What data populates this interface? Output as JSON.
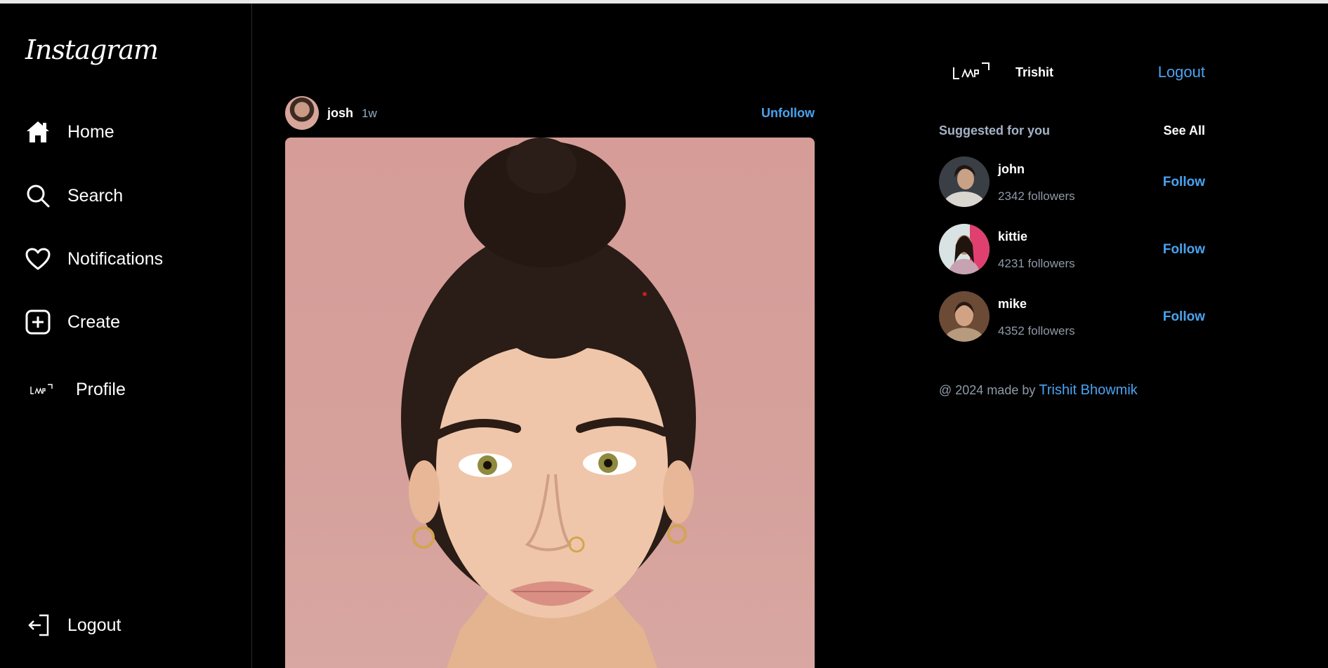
{
  "app": {
    "logo_text": "Instagram"
  },
  "sidebar": {
    "items": [
      {
        "label": "Home",
        "icon": "home-icon"
      },
      {
        "label": "Search",
        "icon": "search-icon"
      },
      {
        "label": "Notifications",
        "icon": "heart-icon"
      },
      {
        "label": "Create",
        "icon": "plus-square-icon"
      },
      {
        "label": "Profile",
        "icon": "profile-logo-icon"
      }
    ],
    "logout_label": "Logout"
  },
  "post": {
    "username": "josh",
    "time": "1w",
    "unfollow_label": "Unfollow"
  },
  "current_user": {
    "name": "Trishit",
    "logout_label": "Logout"
  },
  "suggestions": {
    "title": "Suggested for you",
    "see_all_label": "See All",
    "items": [
      {
        "name": "john",
        "followers": "2342 followers",
        "follow_label": "Follow"
      },
      {
        "name": "kittie",
        "followers": "4231 followers",
        "follow_label": "Follow"
      },
      {
        "name": "mike",
        "followers": "4352 followers",
        "follow_label": "Follow"
      }
    ]
  },
  "footer": {
    "prefix": "@ 2024 made by",
    "author": "Trishit Bhowmik"
  },
  "colors": {
    "background": "#000000",
    "accent": "#4aa3f0",
    "muted": "#8f9aa8"
  }
}
